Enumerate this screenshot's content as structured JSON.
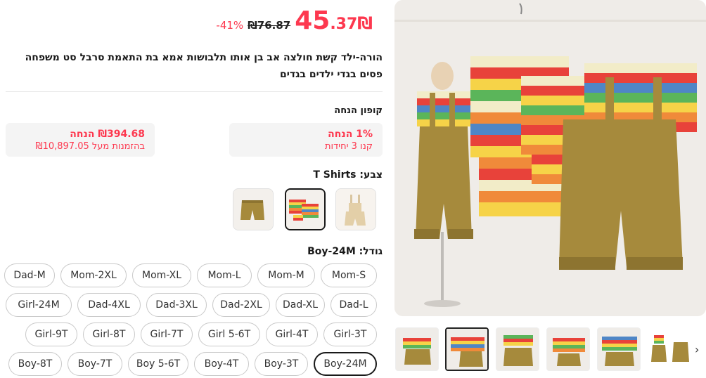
{
  "price": {
    "currency": "₪",
    "integer": "45",
    "decimal": ".37",
    "old_price": "₪76.87",
    "discount": "41%-"
  },
  "title": "הורה-ילד קשת חולצה אב בן אותו תלבושות אמא בת התאמת סרבל סט משפחה פסים בגדי ילדים בגדים",
  "coupon": {
    "heading": "קופון הנחה",
    "items": [
      {
        "line1": "1% הנחה",
        "line2": "קנו 3 יחידות"
      },
      {
        "line1": "₪394.68 הנחה",
        "line2": "בהזמנות מעל ₪10,897.05"
      }
    ]
  },
  "color": {
    "label": "צבע: T Shirts",
    "options": [
      "overalls",
      "T Shirts",
      "shorts"
    ]
  },
  "size": {
    "label": "גודל: Boy-24M",
    "rows": [
      [
        "Mom-S",
        "Mom-M",
        "Mom-L",
        "Mom-XL",
        "Mom-2XL",
        "Dad-M"
      ],
      [
        "Dad-L",
        "Dad-XL",
        "Dad-2XL",
        "Dad-3XL",
        "Dad-4XL",
        "Girl-24M"
      ],
      [
        "Girl-3T",
        "Girl-4T",
        "Girl 5-6T",
        "Girl-7T",
        "Girl-8T",
        "Girl-9T"
      ],
      [
        "Boy-24M",
        "Boy-3T",
        "Boy-4T",
        "Boy 5-6T",
        "Boy-7T",
        "Boy-8T"
      ]
    ],
    "selected": "Boy-24M"
  },
  "gallery": {
    "thumb_count": 6,
    "selected_index": 1,
    "next_icon": "chevron-right-icon"
  },
  "colors": {
    "accent": "#fd384f"
  }
}
